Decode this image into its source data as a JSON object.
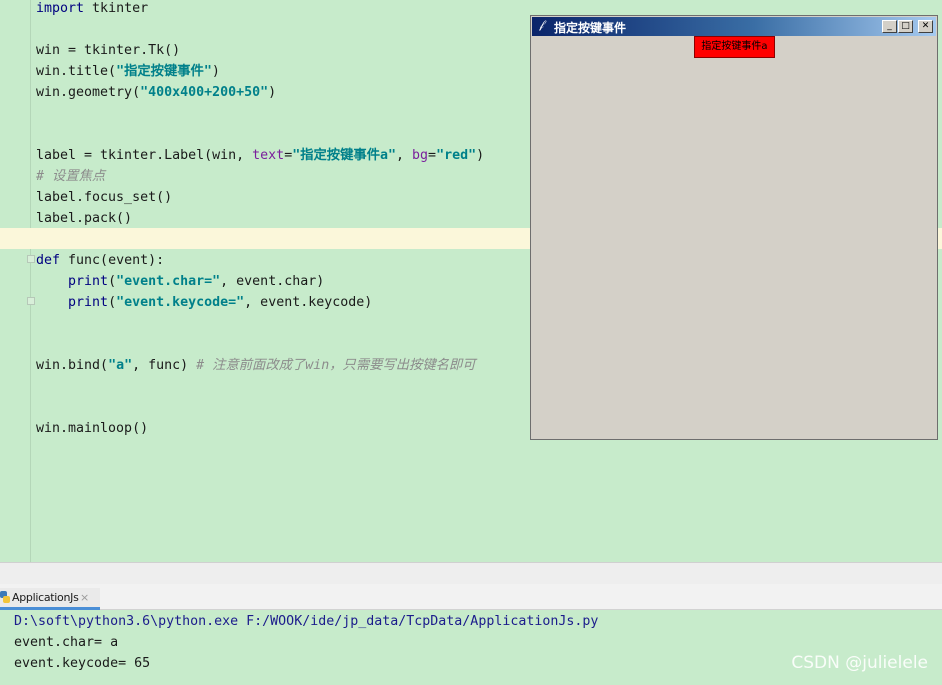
{
  "editor": {
    "lines": [
      {
        "kw": "import",
        "rest": " tkinter"
      },
      {
        "text": "win = tkinter.Tk()"
      },
      {
        "pre": "win.title(",
        "str": "\"指定按键事件\"",
        "post": ")"
      },
      {
        "pre": "win.geometry(",
        "str": "\"400x400+200+50\"",
        "post": ")"
      },
      {
        "pre": "label = tkinter.Label(win, ",
        "kw1": "text",
        "eq1": "=",
        "str1": "\"指定按键事件a\"",
        "mid": ", ",
        "kw2": "bg",
        "eq2": "=",
        "str2": "\"red\"",
        "post": ")"
      },
      {
        "comment": "# 设置焦点"
      },
      {
        "text": "label.focus_set()"
      },
      {
        "text": "label.pack()"
      },
      {
        "kw": "def",
        "rest": " func(event):"
      },
      {
        "indent": "    ",
        "fn": "print",
        "pre": "(",
        "str": "\"event.char=\"",
        "post": ", event.char)"
      },
      {
        "indent": "    ",
        "fn": "print",
        "pre": "(",
        "str": "\"event.keycode=\"",
        "post": ", event.keycode)"
      },
      {
        "pre": "win.bind(",
        "str": "\"a\"",
        "post": ", func) ",
        "comment": "# 注意前面改成了win，只需要写出按键名即可"
      },
      {
        "text": "win.mainloop()"
      }
    ]
  },
  "tk_window": {
    "icon": "feather-icon",
    "title": "指定按键事件",
    "min_glyph": "_",
    "max_glyph": "□",
    "close_glyph": "✕",
    "label_text": "指定按键事件a",
    "label_bg": "#ff0000"
  },
  "run_panel": {
    "tab_label": "ApplicationJs",
    "tab_close": "×",
    "console": [
      "D:\\soft\\python3.6\\python.exe F:/WOOK/ide/jp_data/TcpData/ApplicationJs.py",
      "event.char= a",
      "event.keycode= 65"
    ]
  },
  "watermark": "CSDN @julielele"
}
